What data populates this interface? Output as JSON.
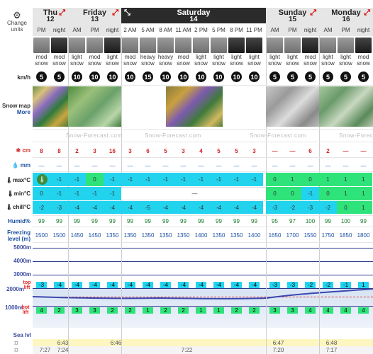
{
  "sidebar": {
    "change_units": "Change units",
    "kmh": "km/h",
    "snow_map": "Snow map",
    "more": "More",
    "snow_cm": "cm",
    "rain_mm": "mm",
    "max": "max°C",
    "min": "min°C",
    "chill": "chill°C",
    "humid": "Humid%",
    "freezing": "Freezing level (m)",
    "alts": [
      "5000m",
      "4000m",
      "3000m",
      "2000m",
      "1000m",
      "Sea lvl"
    ],
    "top_lift": "top lift",
    "bot_lift": "bot lift"
  },
  "days": [
    {
      "name": "Thu",
      "date": "12",
      "arrow": "expand"
    },
    {
      "name": "Friday",
      "date": "13",
      "arrow": "expand"
    },
    {
      "name": "Saturday",
      "date": "14",
      "arrow": "collapse"
    },
    {
      "name": "Sunday",
      "date": "15",
      "arrow": "expand"
    },
    {
      "name": "Monday",
      "date": "16",
      "arrow": "expand"
    }
  ],
  "periods": [
    "PM",
    "night",
    "AM",
    "PM",
    "night",
    "2 AM",
    "5 AM",
    "8 AM",
    "11 AM",
    "2 PM",
    "5 PM",
    "8 PM",
    "11 PM",
    "AM",
    "PM",
    "night",
    "AM",
    "PM",
    "night"
  ],
  "weather": [
    "mod snow",
    "mod snow",
    "light snow",
    "mod snow",
    "light snow",
    "mod snow",
    "heavy snow",
    "heavy snow",
    "mod snow",
    "light snow",
    "light snow",
    "light snow",
    "light snow",
    "light snow",
    "light snow",
    "mod snow",
    "light snow",
    "light snow",
    "mod snow"
  ],
  "wind": [
    "5",
    "5",
    "10",
    "10",
    "10",
    "10",
    "15",
    "10",
    "10",
    "10",
    "10",
    "10",
    "10",
    "5",
    "5",
    "5",
    "5",
    "5",
    "5"
  ],
  "watermark": "Snow-Forecast.com",
  "snow": [
    "8",
    "8",
    "2",
    "3",
    "16",
    "3",
    "6",
    "5",
    "3",
    "4",
    "5",
    "5",
    "3",
    "—",
    "—",
    "6",
    "2",
    "—",
    "—"
  ],
  "rain": [
    "—",
    "—",
    "—",
    "—",
    "—",
    "—",
    "—",
    "—",
    "—",
    "—",
    "—",
    "—",
    "—",
    "—",
    "—",
    "—",
    "—",
    "—",
    "—"
  ],
  "max": [
    "",
    "-1",
    "-1",
    "0",
    "-1",
    "-1",
    "-1",
    "-1",
    "-1",
    "-1",
    "-1",
    "-1",
    "-1",
    "0",
    "1",
    "0",
    "1",
    "1",
    "1"
  ],
  "min": [
    "0",
    "-1",
    "-1",
    "-1",
    "-1",
    "",
    "",
    "",
    "",
    "—",
    "",
    "",
    "",
    "0",
    "0",
    "-1",
    "0",
    "1",
    "1"
  ],
  "chill": [
    "-2",
    "-3",
    "-4",
    "-4",
    "-4",
    "-4",
    "-5",
    "-4",
    "-4",
    "-4",
    "-4",
    "-4",
    "-4",
    "-3",
    "-2",
    "-3",
    "-2",
    "0",
    "1"
  ],
  "humid": [
    "99",
    "99",
    "99",
    "99",
    "99",
    "99",
    "99",
    "99",
    "99",
    "99",
    "99",
    "99",
    "99",
    "95",
    "97",
    "100",
    "99",
    "100",
    "99"
  ],
  "freezing": [
    "1500",
    "1500",
    "1450",
    "1450",
    "1350",
    "1350",
    "1350",
    "1350",
    "1350",
    "1400",
    "1350",
    "1350",
    "1400",
    "1650",
    "1700",
    "1550",
    "1750",
    "1850",
    "1800"
  ],
  "top_lift": [
    "-3",
    "-4",
    "-4",
    "-4",
    "-4",
    "-4",
    "-4",
    "-4",
    "-4",
    "-4",
    "-4",
    "-4",
    "-4",
    "-3",
    "-3",
    "-2",
    "-2",
    "-1",
    "1"
  ],
  "bot_lift": [
    "4",
    "2",
    "3",
    "3",
    "2",
    "2",
    "1",
    "2",
    "2",
    "1",
    "1",
    "2",
    "2",
    "3",
    "3",
    "4",
    "4",
    "4",
    "4"
  ],
  "sunrise": [
    "",
    "6:43",
    "",
    "",
    "6:46",
    "",
    "",
    "",
    "",
    "",
    "",
    "",
    "",
    "6:47",
    "",
    "",
    "6:48",
    "",
    ""
  ],
  "sunset": [
    "7:27",
    "7:24",
    "",
    "",
    "",
    "",
    "",
    "",
    "7:22",
    "",
    "",
    "",
    "",
    "7:20",
    "",
    "",
    "7:17",
    "",
    ""
  ]
}
